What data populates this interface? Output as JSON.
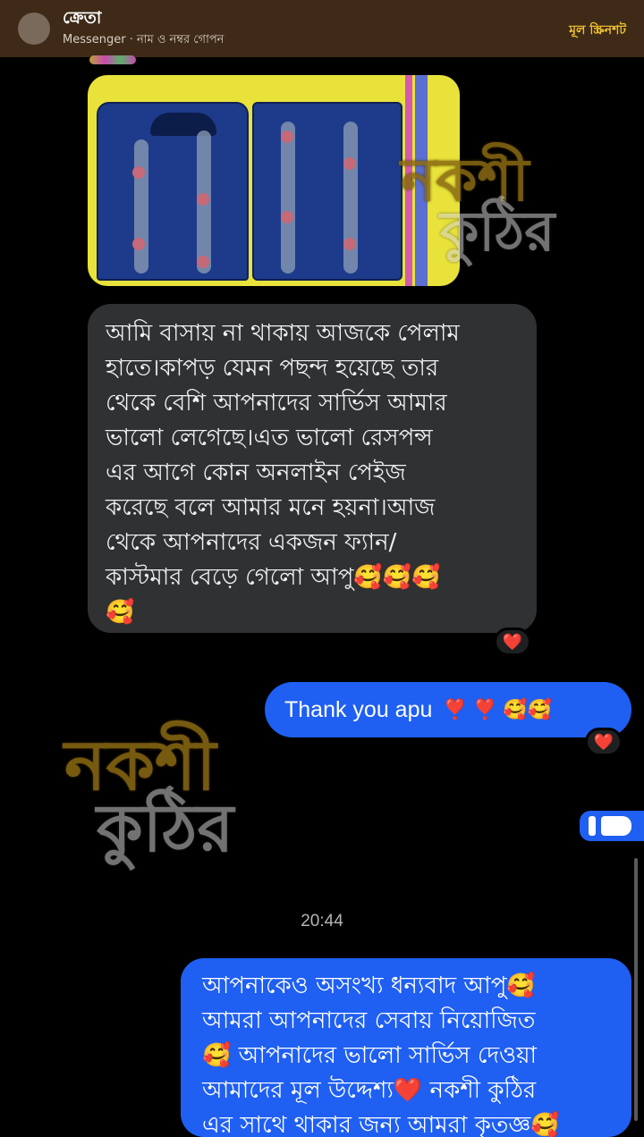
{
  "header": {
    "name": "ক্রেতা",
    "subtitle": "Messenger · নাম ও নম্বর গোপন",
    "link": "মূল স্ক্রিনশট"
  },
  "watermark": {
    "line1": "নকশী",
    "line2": "কুঠির"
  },
  "messages": {
    "incoming_text": "আমি বাসায় না থাকায় আজকে পেলাম\nহাতে।কাপড় যেমন পছন্দ হয়েছে তার\nথেকে বেশি আপনাদের সার্ভিস আমার\nভালো লেগেছে।এত ভালো রেসপন্স\nএর আগে কোন অনলাইন পেইজ\nকরেছে বলে আমার মনে হয়না।আজ\nথেকে আপনাদের একজন ফ্যান/\nকাস্টমার বেড়ে গেলো আপু🥰🥰🥰\n🥰",
    "incoming_reaction": "❤️",
    "outgoing1_text": "Thank you apu",
    "outgoing1_emoji": "❣️ ❣️ 🥰🥰",
    "outgoing1_reaction": "❤️",
    "time": "20:44",
    "outgoing2_text": "আপনাকেও অসংখ্য ধন্যবাদ আপু🥰\nআমরা আপনাদের সেবায় নিয়োজিত\n🥰 আপনাদের ভালো সার্ভিস দেওয়া\nআমাদের মূল উদ্দেশ্য❤️ নকশী কুঠির\nএর সাথে থাকার জন্য আমরা কৃতজ্ঞ🥰"
  },
  "colors": {
    "header_bg": "#3e2a17",
    "link": "#f2c230",
    "incoming_bg": "#2f3133",
    "outgoing_bg": "#1f5ff2"
  }
}
